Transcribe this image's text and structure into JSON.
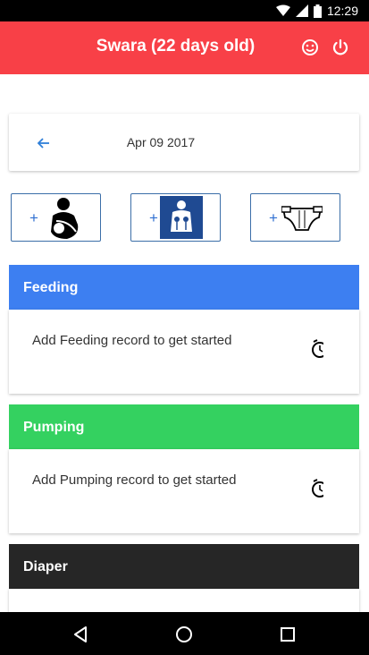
{
  "status_bar": {
    "time": "12:29",
    "icons": [
      "wifi-icon",
      "signal-icon",
      "battery-icon"
    ]
  },
  "app_bar": {
    "title": "Swara (22 days old)",
    "background": "#f84047",
    "actions": [
      "smiley-icon",
      "power-icon"
    ]
  },
  "date_nav": {
    "date": "Apr 09 2017",
    "back_icon": "arrow-left-icon"
  },
  "add_buttons": [
    {
      "label": "+",
      "icon": "breastfeeding-icon"
    },
    {
      "label": "+",
      "icon": "breast-pump-icon"
    },
    {
      "label": "+",
      "icon": "diaper-icon"
    }
  ],
  "sections": [
    {
      "title": "Feeding",
      "color": "#3d7ff1",
      "message": "Add Feeding record to get started"
    },
    {
      "title": "Pumping",
      "color": "#34d160",
      "message": "Add Pumping record to get started"
    },
    {
      "title": "Diaper",
      "color": "#262626"
    }
  ],
  "nav_bar": {
    "buttons": [
      "back-triangle-icon",
      "home-circle-icon",
      "recents-square-icon"
    ]
  }
}
